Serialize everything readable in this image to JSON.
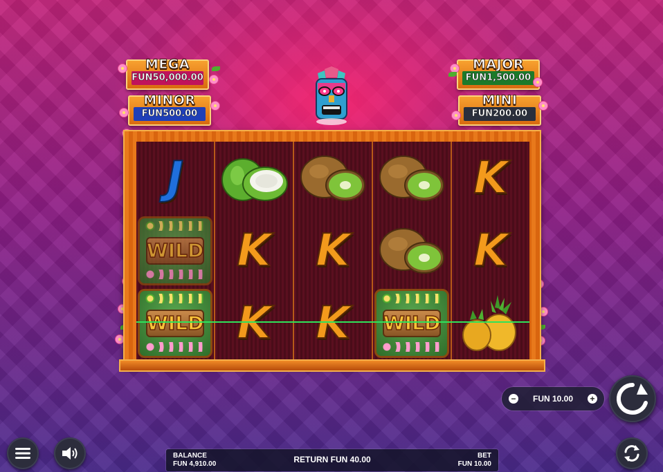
{
  "jackpots": {
    "mega": {
      "title": "MEGA",
      "value": "FUN50,000.00"
    },
    "minor": {
      "title": "MINOR",
      "value": "FUN500.00"
    },
    "major": {
      "title": "MAJOR",
      "value": "FUN1,500.00"
    },
    "mini": {
      "title": "MINI",
      "value": "FUN200.00"
    }
  },
  "reels": [
    [
      "J",
      "WILD",
      "WILD"
    ],
    [
      "coconut",
      "K",
      "K"
    ],
    [
      "kiwi",
      "K",
      "K"
    ],
    [
      "kiwi",
      "kiwi",
      "WILD"
    ],
    [
      "K",
      "K",
      "pineapple"
    ]
  ],
  "bet_control": {
    "minus": "−",
    "value": "FUN 10.00",
    "plus": "+"
  },
  "bottom_bar": {
    "balance_label": "BALANCE",
    "balance_value": "FUN 4,910.00",
    "return_text": "RETURN FUN 40.00",
    "bet_label": "BET",
    "bet_value": "FUN 10.00"
  },
  "icons": {
    "menu": "menu-icon",
    "sound": "speaker-icon",
    "spin": "spin-icon",
    "autoplay": "autoplay-icon"
  },
  "colors": {
    "win_line": "#2ee35a",
    "k_symbol": "#f39a1c",
    "j_symbol": "#1f6fdc"
  }
}
